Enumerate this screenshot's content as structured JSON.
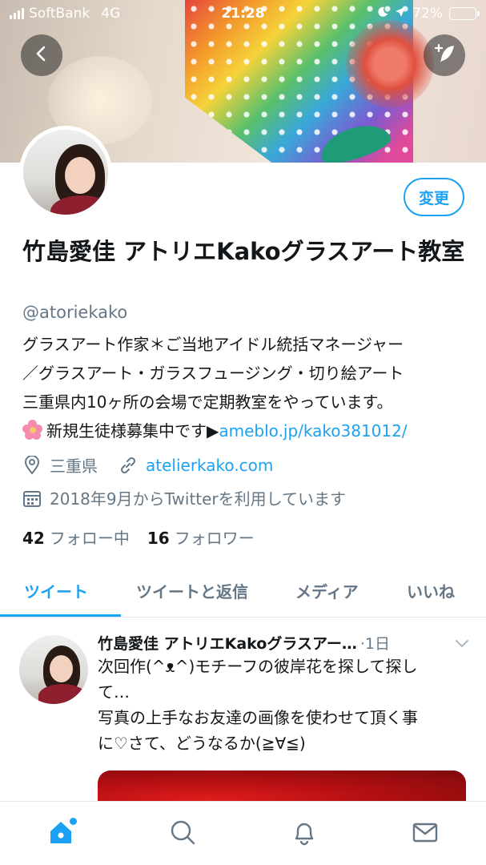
{
  "status_bar": {
    "carrier": "SoftBank",
    "network": "4G",
    "time": "21:28",
    "battery": "72%",
    "battery_level": 0.72
  },
  "header": {
    "back_icon": "chevron-left-icon",
    "compose_icon": "compose-feather-icon"
  },
  "profile": {
    "edit_label": "変更",
    "name": "竹島愛佳 アトリエKakoグラスアート教室",
    "handle": "@atoriekako",
    "bio": {
      "line1": "グラスアート作家＊ご当地アイドル統括マネージャー",
      "line2": "／グラスアート・ガラスフュージング・切り絵アート",
      "line3": "三重県内10ヶ所の会場で定期教室をやっています。",
      "line4_text": "新規生徒様募集中です▶",
      "line4_link": "ameblo.jp/kako381012/"
    },
    "location": "三重県",
    "website": "atelierkako.com",
    "joined": "2018年9月からTwitterを利用しています",
    "following_count": "42",
    "following_label": "フォロー中",
    "followers_count": "16",
    "followers_label": "フォロワー"
  },
  "tabs": [
    {
      "label": "ツイート",
      "active": true
    },
    {
      "label": "ツイートと返信",
      "active": false
    },
    {
      "label": "メディア",
      "active": false
    },
    {
      "label": "いいね",
      "active": false
    }
  ],
  "tweet": {
    "name": "竹島愛佳 アトリエKakoグラスアー…",
    "time": "·1日",
    "lines": [
      "次回作(^ᴥ^)モチーフの彼岸花を探して探し",
      "て…",
      "写真の上手なお友達の画像を使わせて頂く事",
      "に♡さて、どうなるか(≧∀≦)"
    ]
  },
  "bottom_nav": [
    {
      "icon": "home-icon",
      "active": true
    },
    {
      "icon": "search-icon",
      "active": false
    },
    {
      "icon": "bell-icon",
      "active": false
    },
    {
      "icon": "mail-icon",
      "active": false
    }
  ],
  "colors": {
    "accent": "#1da1f2",
    "text": "#14171a",
    "secondary": "#657786"
  }
}
